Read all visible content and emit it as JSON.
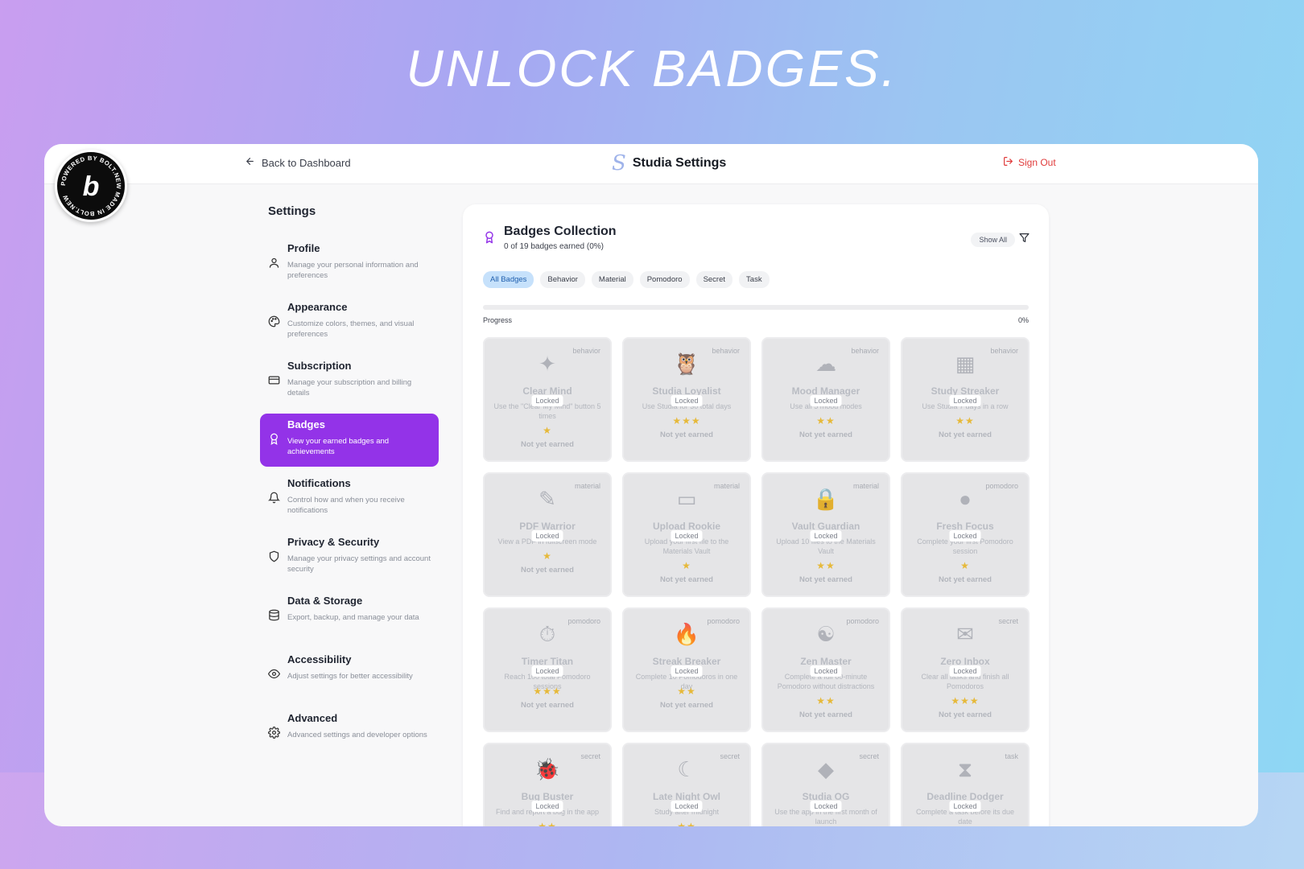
{
  "headline": "UNLOCK BADGES.",
  "powered_badge": "POWERED BY BOLT.NEW MADE IN BOLT.NEW",
  "topbar": {
    "back_label": "Back to Dashboard",
    "brand_logo": "S",
    "brand_title": "Studia Settings",
    "signout_label": "Sign Out"
  },
  "sidebar": {
    "title": "Settings",
    "items": [
      {
        "label": "Profile",
        "desc": "Manage your personal information and preferences",
        "icon": "user-icon"
      },
      {
        "label": "Appearance",
        "desc": "Customize colors, themes, and visual preferences",
        "icon": "palette-icon"
      },
      {
        "label": "Subscription",
        "desc": "Manage your subscription and billing details",
        "icon": "credit-card-icon"
      },
      {
        "label": "Badges",
        "desc": "View your earned badges and achievements",
        "icon": "award-icon",
        "active": true
      },
      {
        "label": "Notifications",
        "desc": "Control how and when you receive notifications",
        "icon": "bell-icon"
      },
      {
        "label": "Privacy & Security",
        "desc": "Manage your privacy settings and account security",
        "icon": "shield-icon"
      },
      {
        "label": "Data & Storage",
        "desc": "Export, backup, and manage your data",
        "icon": "database-icon"
      },
      {
        "label": "Accessibility",
        "desc": "Adjust settings for better accessibility",
        "icon": "eye-icon"
      },
      {
        "label": "Advanced",
        "desc": "Advanced settings and developer options",
        "icon": "gear-icon"
      }
    ]
  },
  "panel": {
    "title": "Badges Collection",
    "subtitle": "0 of 19 badges earned (0%)",
    "show_all": "Show All",
    "chips": [
      "All Badges",
      "Behavior",
      "Material",
      "Pomodoro",
      "Secret",
      "Task"
    ],
    "active_chip": "All Badges",
    "progress_label": "Progress",
    "progress_pct": "0%",
    "progress_value": 0
  },
  "badges": [
    {
      "name": "Clear Mind",
      "category": "behavior",
      "desc": "Use the \"Clear My Mind\" button 5 times",
      "stars": 1,
      "icon": "sparkle-icon",
      "glyph": "✦"
    },
    {
      "name": "Studia Loyalist",
      "category": "behavior",
      "desc": "Use Studia for 30 total days",
      "stars": 3,
      "icon": "owl-icon",
      "glyph": "🦉"
    },
    {
      "name": "Mood Manager",
      "category": "behavior",
      "desc": "Use all 5 mood modes",
      "stars": 2,
      "icon": "brain-icon",
      "glyph": "☁"
    },
    {
      "name": "Study Streaker",
      "category": "behavior",
      "desc": "Use Studia 7 days in a row",
      "stars": 2,
      "icon": "calendar-icon",
      "glyph": "▦"
    },
    {
      "name": "PDF Warrior",
      "category": "material",
      "desc": "View a PDF in fullscreen mode",
      "stars": 1,
      "icon": "pencil-icon",
      "glyph": "✎"
    },
    {
      "name": "Upload Rookie",
      "category": "material",
      "desc": "Upload your first file to the Materials Vault",
      "stars": 1,
      "icon": "folder-icon",
      "glyph": "▭"
    },
    {
      "name": "Vault Guardian",
      "category": "material",
      "desc": "Upload 10 files to the Materials Vault",
      "stars": 2,
      "icon": "lock-icon",
      "glyph": "🔒"
    },
    {
      "name": "Fresh Focus",
      "category": "pomodoro",
      "desc": "Complete your first Pomodoro session",
      "stars": 1,
      "icon": "tomato-icon",
      "glyph": "●"
    },
    {
      "name": "Timer Titan",
      "category": "pomodoro",
      "desc": "Reach 100 total Pomodoro sessions",
      "stars": 3,
      "icon": "stopwatch-icon",
      "glyph": "⏱"
    },
    {
      "name": "Streak Breaker",
      "category": "pomodoro",
      "desc": "Complete 10 Pomodoros in one day",
      "stars": 2,
      "icon": "flame-icon",
      "glyph": "🔥"
    },
    {
      "name": "Zen Master",
      "category": "pomodoro",
      "desc": "Complete a full 60-minute Pomodoro without distractions",
      "stars": 2,
      "icon": "meditation-icon",
      "glyph": "☯"
    },
    {
      "name": "Zero Inbox",
      "category": "secret",
      "desc": "Clear all tasks and finish all Pomodoros",
      "stars": 3,
      "icon": "mailbox-icon",
      "glyph": "✉"
    },
    {
      "name": "Bug Buster",
      "category": "secret",
      "desc": "Find and report a bug in the app",
      "stars": 2,
      "icon": "bug-icon",
      "glyph": "🐞"
    },
    {
      "name": "Late Night Owl",
      "category": "secret",
      "desc": "Study after midnight",
      "stars": 2,
      "icon": "moon-icon",
      "glyph": "☾"
    },
    {
      "name": "Studia OG",
      "category": "secret",
      "desc": "Use the app in the first month of launch",
      "stars": 3,
      "icon": "diamond-icon",
      "glyph": "◆"
    },
    {
      "name": "Deadline Dodger",
      "category": "task",
      "desc": "Complete a task before its due date",
      "stars": 2,
      "icon": "hourglass-icon",
      "glyph": "⧗"
    }
  ],
  "locked_label": "Locked",
  "status_label": "Not yet earned",
  "colors": {
    "accent": "#9333e8",
    "signout": "#e03b3b",
    "star": "#e6b93a",
    "chip_active": "#c6e1fb"
  }
}
